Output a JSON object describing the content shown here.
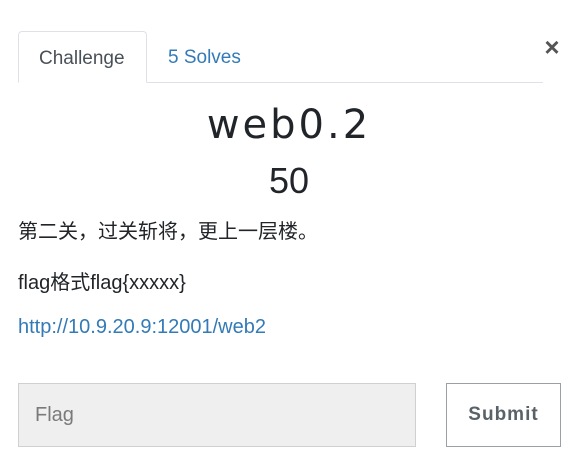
{
  "tabs": {
    "challenge_label": "Challenge",
    "solves_label": "5 Solves"
  },
  "close": {
    "icon": "close-icon",
    "glyph": "×"
  },
  "challenge": {
    "name": "web0.2",
    "value": "50",
    "description_line1": "第二关，过关斩将，更上一层楼。",
    "description_line2": "flag格式flag{xxxxx}",
    "link": "http://10.9.20.9:12001/web2"
  },
  "form": {
    "flag_placeholder": "Flag",
    "flag_value": "",
    "submit_label": "Submit"
  },
  "colors": {
    "link": "#337ab7",
    "border": "#dee2e6",
    "input_bg": "#efefef"
  }
}
